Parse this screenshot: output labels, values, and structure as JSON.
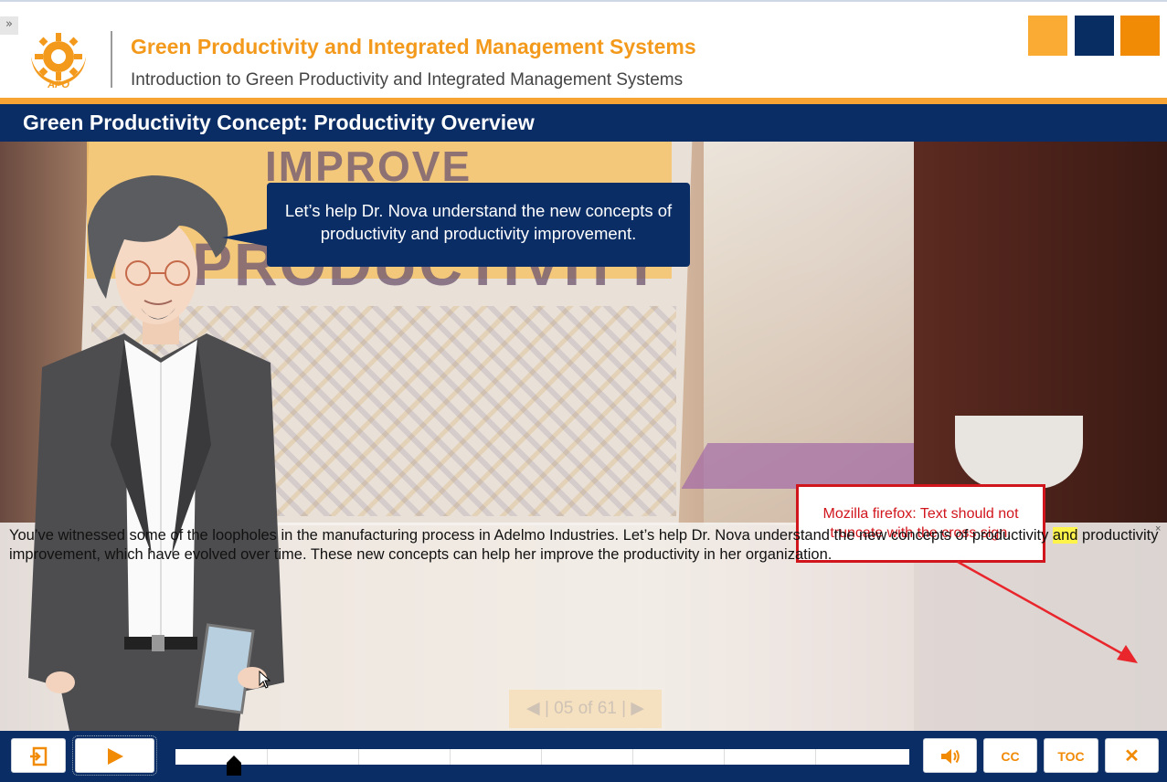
{
  "header": {
    "expand_label": "»",
    "course_title": "Green Productivity and Integrated Management Systems",
    "course_subtitle": "Introduction to Green Productivity and Integrated Management Systems",
    "logo_text": "APO",
    "swatch_colors": [
      "#f9ab33",
      "#072d63",
      "#f18a05"
    ]
  },
  "slide": {
    "title": "Green Productivity Concept: Productivity Overview",
    "background_words": [
      "IMPROVE",
      "PRODUCTIVITY"
    ],
    "speech_bubble": "Let’s help Dr. Nova understand the new concepts of productivity and productivity improvement.",
    "annotation_note": "Mozilla firefox: Text should not truncate with the cross sign.",
    "page_counter": "◀ | 05 of 61 | ▶"
  },
  "caption": {
    "text_before": "You’ve witnessed some of the loopholes in the manufacturing process in Adelmo Industries. Let’s help Dr. Nova understand the new concepts of productivity ",
    "text_highlight": "and",
    "text_after": " productivity improvement, which have evolved over time. These new concepts can help her improve the productivity in her organization.",
    "close_glyph": "×"
  },
  "controls": {
    "exit_icon": "exit-lesson-icon",
    "play_icon": "play-icon",
    "volume_icon": "speaker-icon",
    "cc_label": "CC",
    "toc_label": "TOC",
    "close_label": "✕",
    "progress_fraction": 0.08
  },
  "colors": {
    "navy": "#0b2d65",
    "orange": "#f39a1d",
    "note_red": "#d1151c",
    "highlight": "#fff44a"
  }
}
